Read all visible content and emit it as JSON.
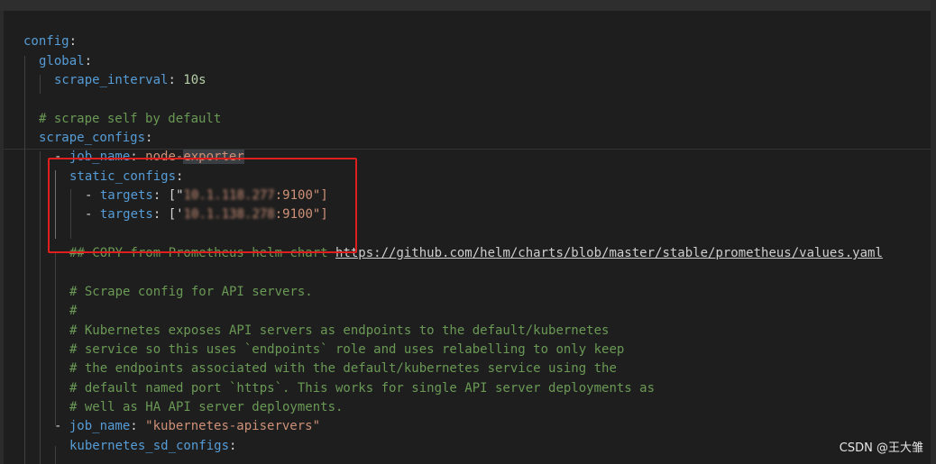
{
  "code": {
    "l1": {
      "key": "config",
      "sep": ":"
    },
    "l2": {
      "key": "global",
      "sep": ":"
    },
    "l3": {
      "key": "scrape_interval",
      "sep": ": ",
      "value": "10s"
    },
    "l4": {
      "comment": "# scrape self by default"
    },
    "l5": {
      "key": "scrape_configs",
      "sep": ":"
    },
    "l6": {
      "dash": "- ",
      "key": "job_name",
      "sep": ": ",
      "value_a": "node-",
      "value_b": "exporter"
    },
    "l7": {
      "key": "static_configs",
      "sep": ":"
    },
    "l8": {
      "dash": "- ",
      "key": "targets",
      "sep": ": ",
      "open": "[\"",
      "blurred": "10.1.118.277",
      "tail": ":9100\"]"
    },
    "l9": {
      "dash": "- ",
      "key": "targets",
      "sep": ": ",
      "open": "['",
      "blurred": "10.1.138.278",
      "tail": ":9100\"]"
    },
    "l10": {
      "comment": "## COPY from Prometheus helm chart ",
      "link": "https://github.com/helm/charts/blob/master/stable/prometheus/values.yaml"
    },
    "l11": {
      "comment": "# Scrape config for API servers."
    },
    "l12": {
      "comment": "#"
    },
    "l13": {
      "comment": "# Kubernetes exposes API servers as endpoints to the default/kubernetes"
    },
    "l14": {
      "comment": "# service so this uses `endpoints` role and uses relabelling to only keep"
    },
    "l15": {
      "comment": "# the endpoints associated with the default/kubernetes service using the"
    },
    "l16": {
      "comment": "# default named port `https`. This works for single API server deployments as"
    },
    "l17": {
      "comment": "# well as HA API server deployments."
    },
    "l18": {
      "dash": "- ",
      "key": "job_name",
      "sep": ": ",
      "value": "\"kubernetes-apiservers\""
    },
    "l19": {
      "key": "kubernetes_sd_configs",
      "sep": ":"
    }
  },
  "watermark": "CSDN @王大雏",
  "colors": {
    "background": "#1e1e1e",
    "key": "#569cd6",
    "string": "#ce9178",
    "number": "#b5cea8",
    "comment": "#6a9955",
    "highlight_box": "#e01e1e"
  }
}
